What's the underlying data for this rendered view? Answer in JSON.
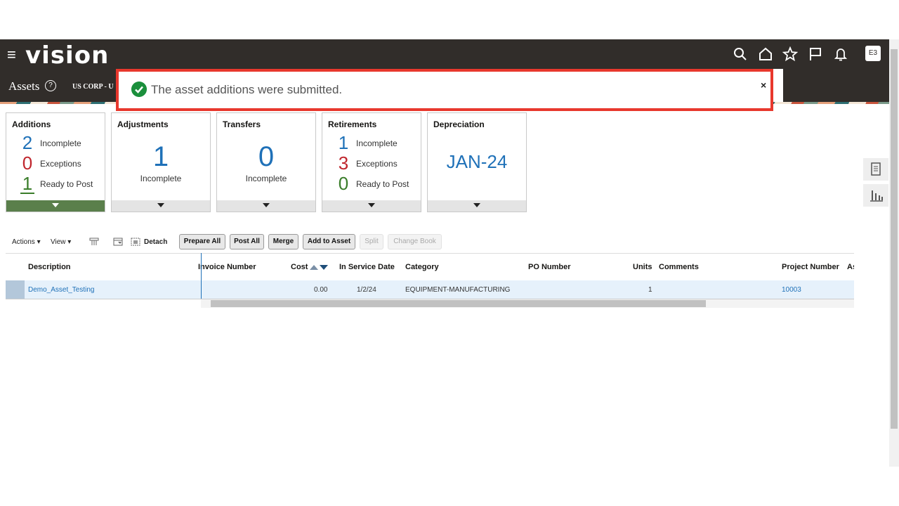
{
  "header": {
    "logo": "vision",
    "page_title": "Assets",
    "help_glyph": "?",
    "business_unit": "US CORP - U",
    "user_initials": "E3",
    "icons": [
      "menu-icon",
      "search-icon",
      "home-icon",
      "star-icon",
      "flag-icon",
      "bell-icon"
    ]
  },
  "banner": {
    "message": "The asset additions were submitted.",
    "close": "×",
    "highlight_color": "#e8382d"
  },
  "cards": {
    "additions": {
      "title": "Additions",
      "rows": [
        {
          "value": "2",
          "label": "Incomplete"
        },
        {
          "value": "0",
          "label": "Exceptions"
        },
        {
          "value": "1",
          "label": "Ready to Post"
        }
      ]
    },
    "adjustments": {
      "title": "Adjustments",
      "value": "1",
      "label": "Incomplete"
    },
    "transfers": {
      "title": "Transfers",
      "value": "0",
      "label": "Incomplete"
    },
    "retirements": {
      "title": "Retirements",
      "rows": [
        {
          "value": "1",
          "label": "Incomplete"
        },
        {
          "value": "3",
          "label": "Exceptions"
        },
        {
          "value": "0",
          "label": "Ready to Post"
        }
      ]
    },
    "depreciation": {
      "title": "Depreciation",
      "value": "JAN-24"
    }
  },
  "toolbar": {
    "actions": "Actions ▾",
    "view": "View ▾",
    "detach": "Detach",
    "buttons": [
      "Prepare All",
      "Post All",
      "Merge",
      "Add to Asset",
      "Split",
      "Change Book"
    ]
  },
  "table": {
    "columns": [
      "Description",
      "Invoice Number",
      "Cost",
      "In Service Date",
      "Category",
      "PO Number",
      "Units",
      "Comments",
      "Project Number",
      "As"
    ],
    "rows": [
      {
        "description": "Demo_Asset_Testing",
        "invoice": "",
        "cost": "0.00",
        "in_service": "1/2/24",
        "category": "EQUIPMENT-MANUFACTURING",
        "po": "",
        "units": "1",
        "comments": "",
        "project": "10003"
      }
    ]
  },
  "colors": {
    "header_bg": "#312d2a",
    "accent_blue": "#1f71b8",
    "error_red": "#c0262d",
    "success_green": "#3a7d2a"
  }
}
